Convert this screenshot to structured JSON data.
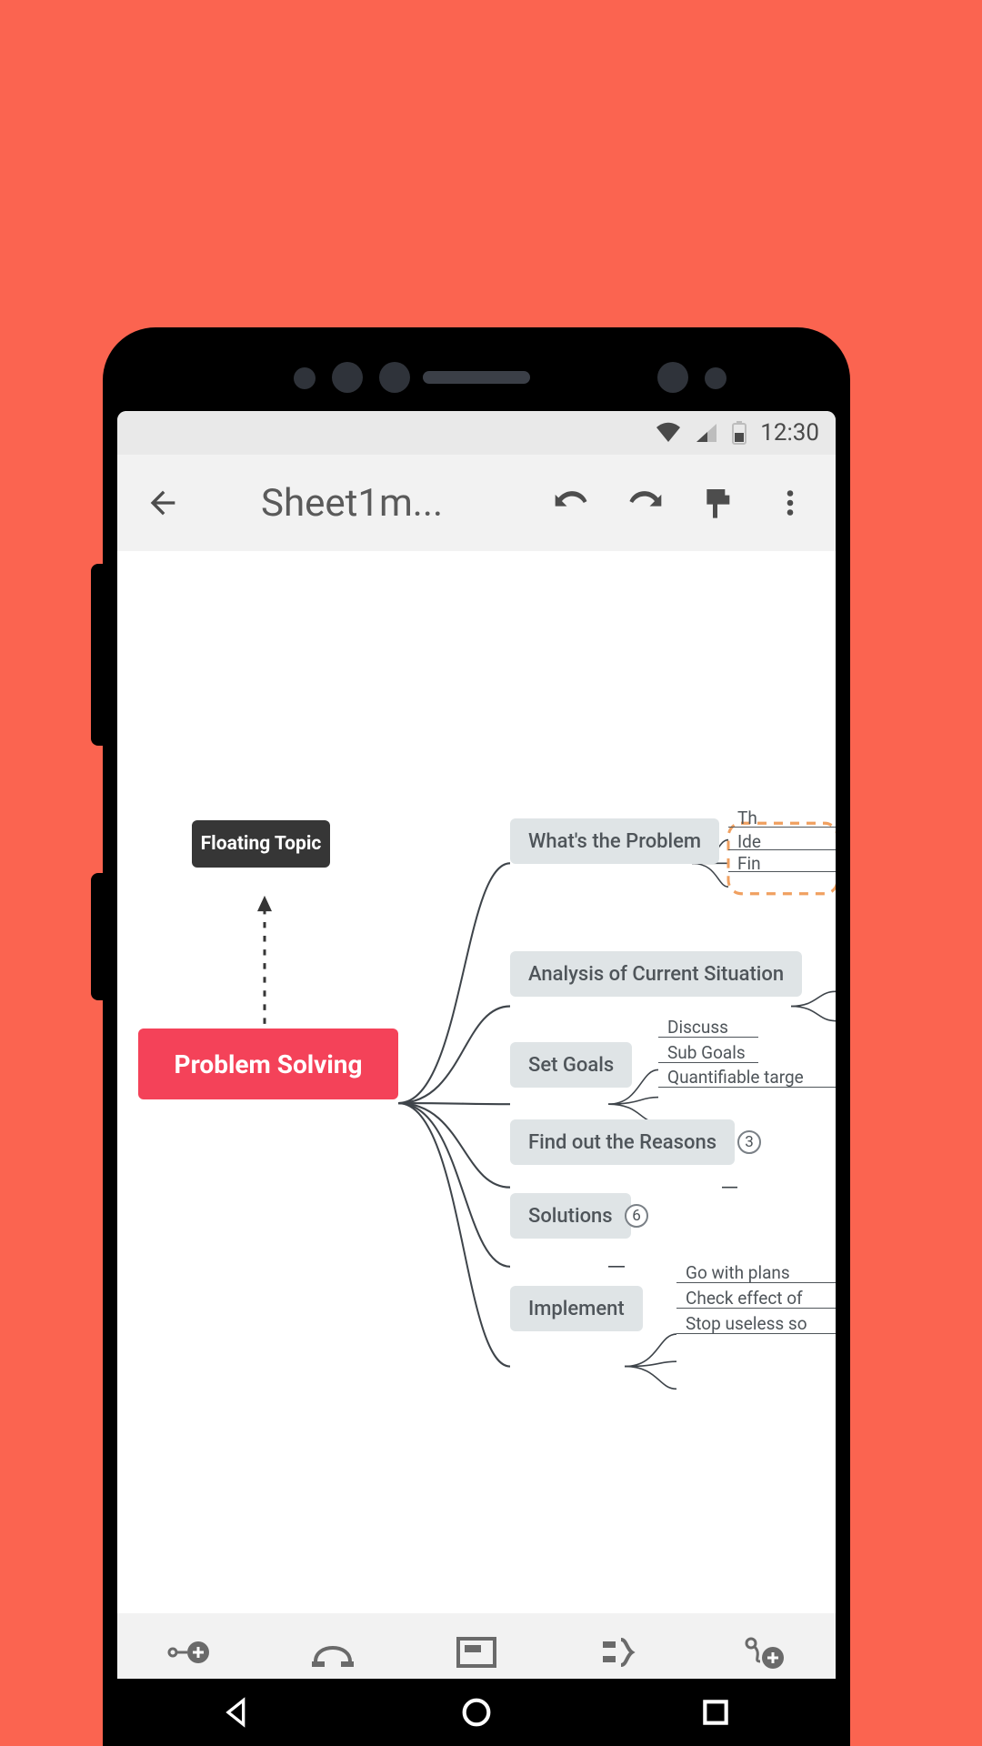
{
  "status": {
    "time": "12:30"
  },
  "appbar": {
    "title": "Sheet1m..."
  },
  "mindmap": {
    "floating": "Floating Topic",
    "root": "Problem Solving",
    "branches": {
      "b1": "What's the Problem",
      "b2": "Analysis of Current Situation",
      "b3": "Set Goals",
      "b4": "Find out the Reasons",
      "b5": "Solutions",
      "b6": "Implement"
    },
    "b1_children": {
      "c1": "Th",
      "c2": "Ide",
      "c3": "Fin"
    },
    "b3_children": {
      "c1": "Discuss",
      "c2": "Sub Goals",
      "c3": "Quantifiable targe"
    },
    "b4_count": "3",
    "b5_count": "6",
    "b6_children": {
      "c1": "Go with plans",
      "c2": "Check effect of",
      "c3": "Stop useless so"
    }
  }
}
